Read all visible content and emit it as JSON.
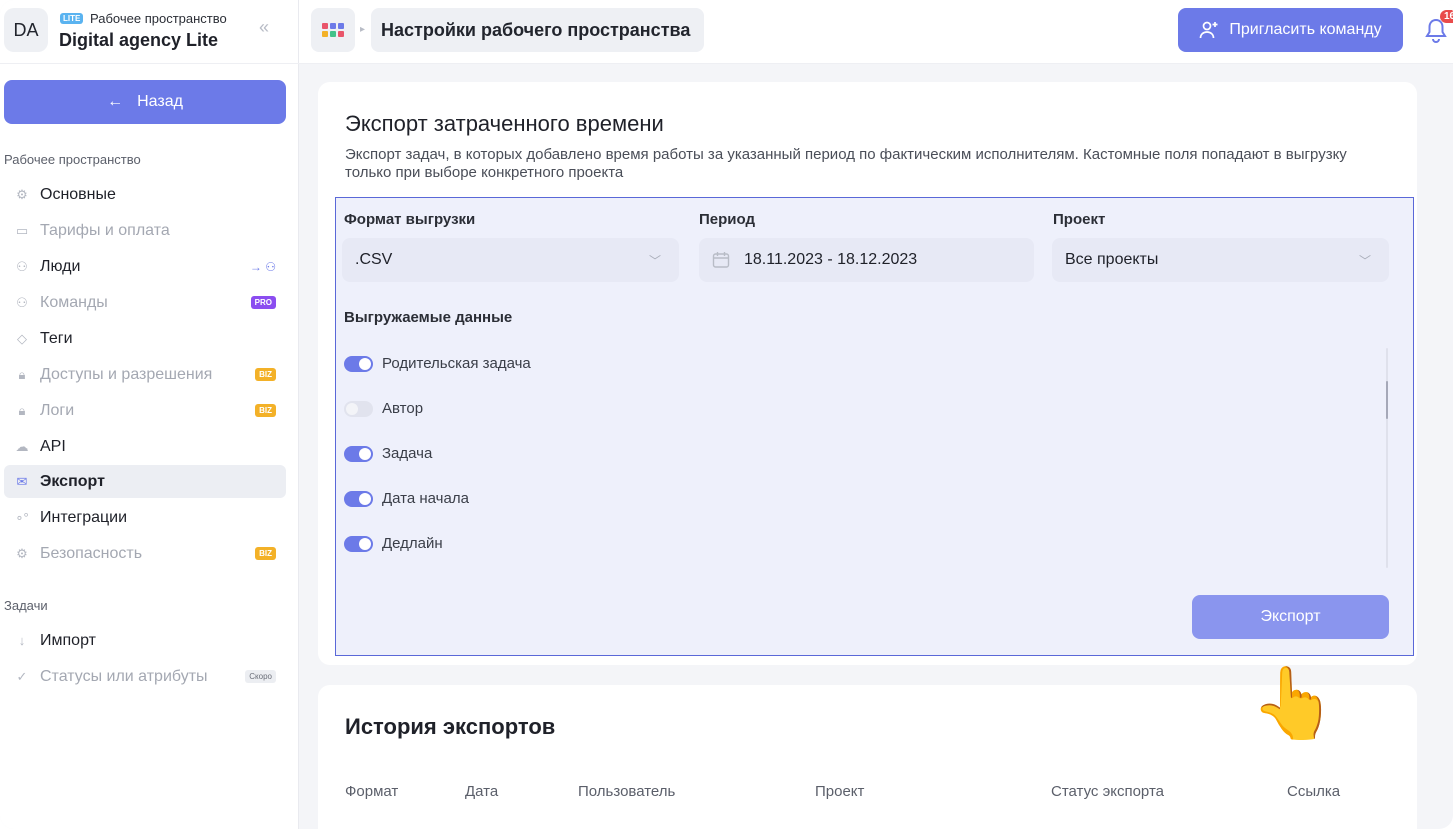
{
  "workspace": {
    "avatar": "DA",
    "plan_badge": "LITE",
    "subtitle": "Рабочее пространство",
    "name": "Digital agency Lite"
  },
  "sidebar": {
    "back_label": "Назад",
    "section_workspace": "Рабочее пространство",
    "items": [
      {
        "label": "Основные",
        "icon": "gear-icon",
        "state": "normal"
      },
      {
        "label": "Тарифы и оплата",
        "icon": "card-icon",
        "state": "dim"
      },
      {
        "label": "Люди",
        "icon": "people-icon",
        "state": "normal"
      },
      {
        "label": "Команды",
        "icon": "team-icon",
        "state": "dim",
        "tag": "PRO"
      },
      {
        "label": "Теги",
        "icon": "tag-icon",
        "state": "normal"
      },
      {
        "label": "Доступы и разрешения",
        "icon": "lock-icon",
        "state": "dim",
        "tag": "BIZ"
      },
      {
        "label": "Логи",
        "icon": "lock-icon",
        "state": "dim",
        "tag": "BIZ"
      },
      {
        "label": "API",
        "icon": "cloud-icon",
        "state": "normal"
      },
      {
        "label": "Экспорт",
        "icon": "export-icon",
        "state": "active"
      },
      {
        "label": "Интеграции",
        "icon": "integrations-icon",
        "state": "normal"
      },
      {
        "label": "Безопасность",
        "icon": "gear-icon",
        "state": "dim",
        "tag": "BIZ"
      }
    ],
    "section_tasks": "Задачи",
    "task_items": [
      {
        "label": "Импорт",
        "icon": "import-icon",
        "state": "normal"
      },
      {
        "label": "Статусы или атрибуты",
        "icon": "status-icon",
        "state": "dim",
        "tag": "Скоро"
      }
    ]
  },
  "topbar": {
    "breadcrumb": "Настройки рабочего пространства",
    "invite_label": "Пригласить команду",
    "notifications_count": "16"
  },
  "export_card": {
    "title": "Экспорт затраченного времени",
    "description": "Экспорт задач, в которых добавлено время работы за указанный период по фактическим исполнителям. Кастомные поля попадают в выгрузку только при выборе конкретного проекта",
    "format_label": "Формат выгрузки",
    "format_value": ".CSV",
    "period_label": "Период",
    "period_value": "18.11.2023 - 18.12.2023",
    "project_label": "Проект",
    "project_value": "Все проекты",
    "data_label": "Выгружаемые данные",
    "toggles": [
      {
        "label": "Родительская задача",
        "on": true
      },
      {
        "label": "Автор",
        "on": false
      },
      {
        "label": "Задача",
        "on": true
      },
      {
        "label": "Дата начала",
        "on": true
      },
      {
        "label": "Дедлайн",
        "on": true
      }
    ],
    "export_button": "Экспорт"
  },
  "history": {
    "title": "История экспортов",
    "columns": [
      "Формат",
      "Дата",
      "Пользователь",
      "Проект",
      "Статус экспорта",
      "Ссылка"
    ]
  },
  "colors": {
    "accent": "#6c7ae8",
    "pro": "#8b4df0",
    "biz": "#f3b128",
    "notification": "#e94b4b"
  }
}
